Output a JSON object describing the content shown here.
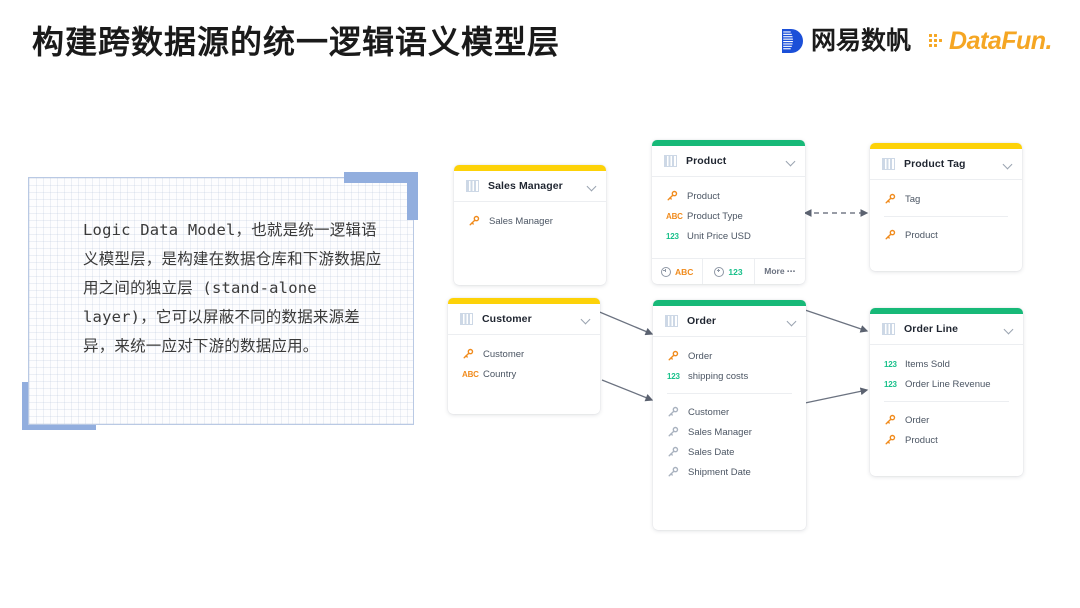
{
  "header": {
    "title": "构建跨数据源的统一逻辑语义模型层",
    "logos": {
      "netease": {
        "name": "netease-logo",
        "text": "网易数帆",
        "color": "#1b4fd8"
      },
      "datafun": {
        "name": "datafun-logo",
        "text": "DataFun.",
        "color": "#f5a623"
      }
    }
  },
  "panel": {
    "name": "logic-data-model-description",
    "text": "Logic Data Model，也就是统一逻辑语义模型层，是构建在数据仓库和下游数据应用之间的独立层 (stand-alone layer)，它可以屏蔽不同的数据来源差异，来统一应对下游的数据应用。",
    "border_color": "#b9c9e4",
    "accent_color": "#92aede"
  },
  "diagram": {
    "colors": {
      "bar_green": "#17b978",
      "bar_yellow": "#fdd208",
      "key_icon": "#f08b1d",
      "abc_icon": "#f08b1d",
      "num_icon": "#18c08a",
      "edge": "#6b7280"
    },
    "cards": [
      {
        "id": "sales-manager",
        "title": "Sales Manager",
        "bar": "yellow",
        "header_icon": "table-icon",
        "chevron": "chevron-down-icon",
        "fields": [
          {
            "icon": "key",
            "label": "Sales Manager"
          }
        ],
        "footer": []
      },
      {
        "id": "product",
        "title": "Product",
        "bar": "green",
        "header_icon": "table-icon",
        "chevron": "chevron-down-icon",
        "fields": [
          {
            "icon": "key",
            "label": "Product"
          },
          {
            "icon": "abc",
            "label": "Product Type"
          },
          {
            "icon": "123",
            "label": "Unit Price USD"
          }
        ],
        "footer": [
          {
            "icon": "plus-circle-icon",
            "label": "ABC",
            "style": "abc"
          },
          {
            "icon": "plus-circle-icon",
            "label": "123",
            "style": "123"
          },
          {
            "icon": "",
            "label": "More ⋯",
            "style": "more"
          }
        ]
      },
      {
        "id": "product-tag",
        "title": "Product Tag",
        "bar": "yellow",
        "header_icon": "table-icon",
        "chevron": "chevron-down-icon",
        "fields": [
          {
            "icon": "key",
            "label": "Tag"
          },
          {
            "icon": "divider",
            "label": ""
          },
          {
            "icon": "key",
            "label": "Product"
          }
        ],
        "footer": []
      },
      {
        "id": "customer",
        "title": "Customer",
        "bar": "yellow",
        "header_icon": "table-icon",
        "chevron": "chevron-down-icon",
        "fields": [
          {
            "icon": "key",
            "label": "Customer"
          },
          {
            "icon": "abc",
            "label": "Country"
          }
        ],
        "footer": []
      },
      {
        "id": "order",
        "title": "Order",
        "bar": "green",
        "header_icon": "table-icon",
        "chevron": "chevron-down-icon",
        "fields": [
          {
            "icon": "key",
            "label": "Order"
          },
          {
            "icon": "123",
            "label": "shipping costs"
          },
          {
            "icon": "divider",
            "label": ""
          },
          {
            "icon": "key-gray",
            "label": "Customer"
          },
          {
            "icon": "key-gray",
            "label": "Sales Manager"
          },
          {
            "icon": "key-gray",
            "label": "Sales Date"
          },
          {
            "icon": "key-gray",
            "label": "Shipment Date"
          }
        ],
        "footer": []
      },
      {
        "id": "order-line",
        "title": "Order Line",
        "bar": "green",
        "header_icon": "table-icon",
        "chevron": "chevron-down-icon",
        "fields": [
          {
            "icon": "123",
            "label": "Items Sold"
          },
          {
            "icon": "123",
            "label": "Order Line Revenue"
          },
          {
            "icon": "divider",
            "label": ""
          },
          {
            "icon": "key",
            "label": "Order"
          },
          {
            "icon": "key",
            "label": "Product"
          }
        ],
        "footer": []
      }
    ],
    "edges": [
      {
        "from": "product",
        "to": "product-tag",
        "style": "dashed",
        "arrows": "both"
      },
      {
        "from": "sales-manager",
        "to": "order",
        "style": "solid",
        "arrows": "end"
      },
      {
        "from": "customer",
        "to": "order",
        "style": "solid",
        "arrows": "end"
      },
      {
        "from": "product",
        "to": "order-line",
        "style": "solid",
        "arrows": "end"
      },
      {
        "from": "order",
        "to": "order-line",
        "style": "solid",
        "arrows": "end"
      }
    ]
  }
}
